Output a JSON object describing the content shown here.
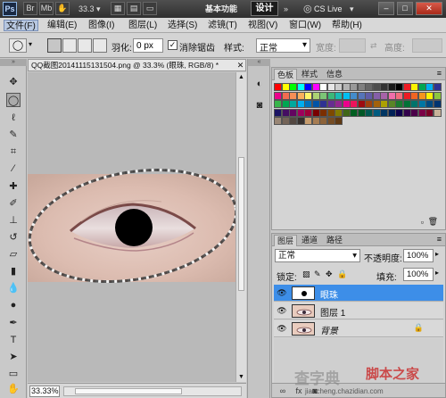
{
  "titlebar": {
    "logo": "Ps",
    "zoom_value": "33.3",
    "workspace_basic": "基本功能",
    "workspace_design": "设计",
    "cs_live": "CS Live"
  },
  "menu": [
    "文件(F)",
    "编辑(E)",
    "图像(I)",
    "图层(L)",
    "选择(S)",
    "滤镜(T)",
    "视图(V)",
    "窗口(W)",
    "帮助(H)"
  ],
  "options": {
    "feather_label": "羽化:",
    "feather_value": "0 px",
    "antialias_label": "消除锯齿",
    "antialias_checked": true,
    "style_label": "样式:",
    "style_value": "正常",
    "width_label": "宽度:",
    "height_label": "高度:"
  },
  "document": {
    "tab_title": "QQ截图20141115131504.png @ 33.3% (眼珠, RGB/8) *",
    "zoom": "33.33%"
  },
  "swatches": {
    "tabs": [
      "色板",
      "样式",
      "信息"
    ],
    "colors": [
      "#ff0000",
      "#ffff00",
      "#00ff00",
      "#00ffff",
      "#0000ff",
      "#ff00ff",
      "#ffffff",
      "#e6e6e6",
      "#cccccc",
      "#b3b3b3",
      "#999999",
      "#808080",
      "#666666",
      "#4d4d4d",
      "#333333",
      "#1a1a1a",
      "#000000",
      "#ed1c24",
      "#fff200",
      "#00a651",
      "#00aeef",
      "#2e3192",
      "#ec008c",
      "#f26c4f",
      "#f68e56",
      "#fbaf5d",
      "#fff568",
      "#acd373",
      "#7cc576",
      "#3bb878",
      "#1abbb4",
      "#00bff3",
      "#438ccb",
      "#5574b9",
      "#605ca8",
      "#855fa8",
      "#a763a8",
      "#f06eaa",
      "#f26d7d",
      "#ed1c24",
      "#f26522",
      "#f7941d",
      "#fff200",
      "#8dc73f",
      "#39b54a",
      "#00a651",
      "#00a99d",
      "#00aeef",
      "#0072bc",
      "#0054a6",
      "#2e3192",
      "#662d91",
      "#92278f",
      "#ec008c",
      "#ed145b",
      "#9e0b0f",
      "#a0410d",
      "#a3620a",
      "#aba000",
      "#598527",
      "#1a7b30",
      "#007236",
      "#00746b",
      "#0076a3",
      "#004a80",
      "#003471",
      "#1b1464",
      "#440e62",
      "#630460",
      "#9e005d",
      "#9e0039",
      "#790000",
      "#7b2e00",
      "#7d4900",
      "#827b00",
      "#406618",
      "#005e20",
      "#005826",
      "#005952",
      "#005b7f",
      "#003663",
      "#002157",
      "#0d004c",
      "#32004b",
      "#4b0049",
      "#7b0046",
      "#7a0026",
      "#c7b299",
      "#998675",
      "#736357",
      "#534741",
      "#37302d",
      "#c69c6d",
      "#a67c52",
      "#8c6239",
      "#754c24",
      "#603913"
    ]
  },
  "layers": {
    "tabs": [
      "图层",
      "通道",
      "路径"
    ],
    "blend_mode": "正常",
    "opacity_label": "不透明度:",
    "opacity_value": "100%",
    "lock_label": "锁定:",
    "fill_label": "填充:",
    "fill_value": "100%",
    "items": [
      {
        "name": "眼珠",
        "selected": true,
        "locked": false
      },
      {
        "name": "图层 1",
        "selected": false,
        "locked": false
      },
      {
        "name": "背景",
        "selected": false,
        "locked": true
      }
    ]
  },
  "watermark": {
    "big": "查字典",
    "red": "脚本之家",
    "small": "jiaocheng.chazidian.com"
  }
}
